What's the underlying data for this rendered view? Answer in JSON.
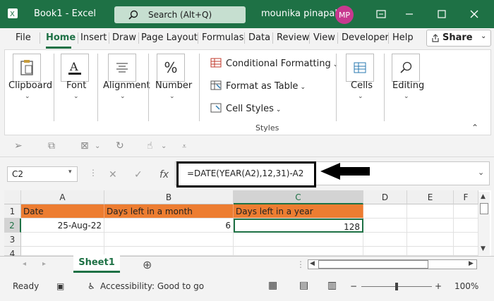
{
  "titlebar": {
    "app_title": "Book1 - Excel",
    "search_placeholder": "Search (Alt+Q)",
    "user_name": "mounika pinapala",
    "user_initials": "MP"
  },
  "menu": {
    "tabs": [
      "File",
      "Home",
      "Insert",
      "Draw",
      "Page Layout",
      "Formulas",
      "Data",
      "Review",
      "View",
      "Developer",
      "Help"
    ],
    "share_label": "Share"
  },
  "ribbon": {
    "clipboard": "Clipboard",
    "font": "Font",
    "alignment": "Alignment",
    "number": "Number",
    "conditional_formatting": "Conditional Formatting",
    "format_as_table": "Format as Table",
    "cell_styles": "Cell Styles",
    "styles_group": "Styles",
    "cells": "Cells",
    "editing": "Editing"
  },
  "formula_bar": {
    "name_box": "C2",
    "formula": "=DATE(YEAR(A2),12,31)-A2"
  },
  "grid": {
    "columns": [
      "A",
      "B",
      "C",
      "D",
      "E",
      "F"
    ],
    "rows": [
      "1",
      "2",
      "3",
      "4"
    ],
    "row1": {
      "a": "Date",
      "b": "Days left in a month",
      "c": "Days left in a year"
    },
    "row2": {
      "a": "25-Aug-22",
      "b": "6",
      "c": "128"
    }
  },
  "sheets": {
    "active": "Sheet1"
  },
  "status": {
    "ready": "Ready",
    "accessibility": "Accessibility: Good to go",
    "zoom": "100%"
  },
  "colors": {
    "excel_green": "#1e7145",
    "header_orange": "#ed7d31",
    "avatar": "#c7398f"
  }
}
